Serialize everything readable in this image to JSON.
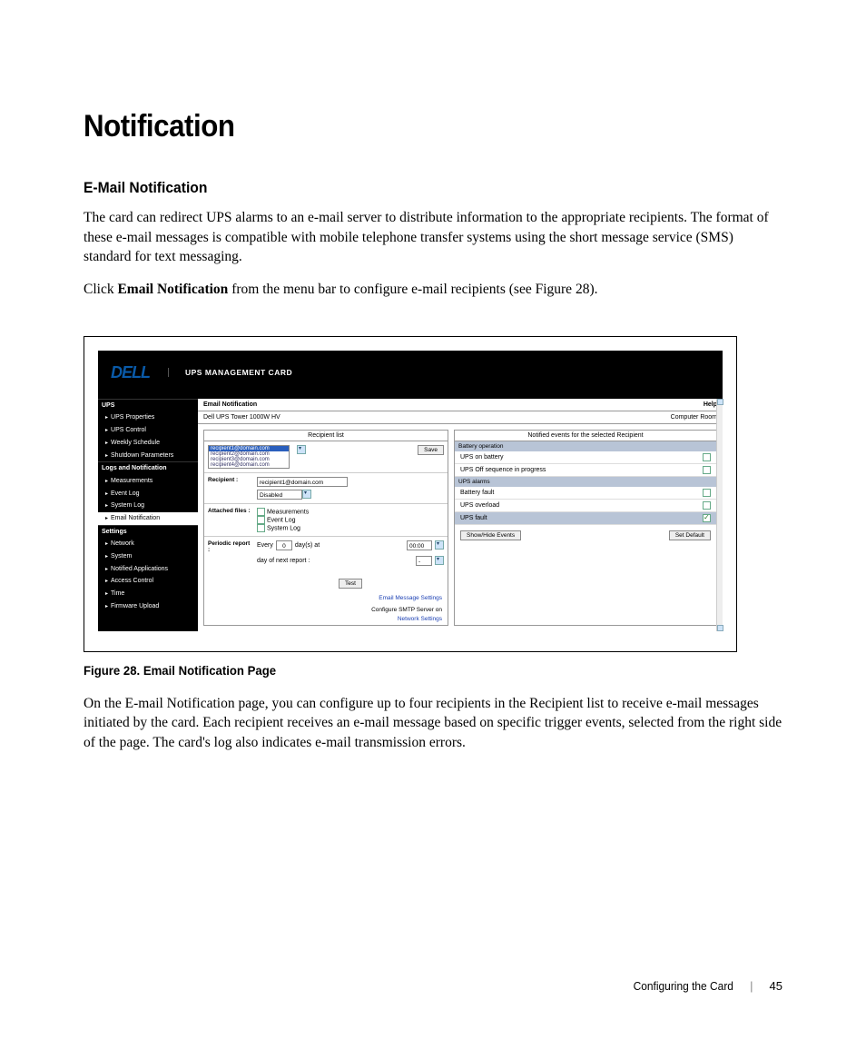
{
  "headings": {
    "h1": "Notification",
    "h2": "E-Mail Notification"
  },
  "paragraphs": {
    "p1": "The card can redirect UPS alarms to an e-mail server to distribute information to the appropriate recipients. The format of these e-mail messages is compatible with mobile telephone transfer systems using the short message service (SMS) standard for text messaging.",
    "p2a": "Click ",
    "p2b": "Email Notification",
    "p2c": " from the menu bar to configure e-mail recipients (see Figure 28).",
    "p3": "On the E-mail Notification page, you can configure up to four recipients in the Recipient list to receive e-mail messages initiated by the card. Each recipient receives an e-mail message based on specific trigger events, selected from the right side of the page. The card's log also indicates e-mail transmission errors."
  },
  "figure_caption": "Figure 28. Email Notification Page",
  "app": {
    "logo": "DELL",
    "title": "UPS MANAGEMENT CARD",
    "sidebar": {
      "sec1": "UPS",
      "s1_items": [
        "UPS Properties",
        "UPS Control",
        "Weekly Schedule",
        "Shutdown Parameters"
      ],
      "sec2": "Logs and Notification",
      "s2_items": [
        "Measurements",
        "Event Log",
        "System Log",
        "Email Notification"
      ],
      "sec3": "Settings",
      "s3_items": [
        "Network",
        "System",
        "Notified Applications",
        "Access Control",
        "Time",
        "Firmware Upload"
      ]
    },
    "bar1_left": "Email Notification",
    "bar1_right": "Help",
    "bar2_left": "Dell UPS Tower 1000W HV",
    "bar2_right": "Computer Room",
    "left_panel": {
      "head": "Recipient list",
      "recipients": [
        "recipient1@domain.com",
        "recipient2@domain.com",
        "recipient3@domain.com",
        "recipient4@domain.com"
      ],
      "save": "Save",
      "recipient_label": "Recipient :",
      "recipient_value": "recipient1@domain.com",
      "disabled": "Disabled",
      "attached_label": "Attached files :",
      "attach_opts": [
        "Measurements",
        "Event Log",
        "System Log"
      ],
      "periodic_label": "Periodic report :",
      "every": "Every",
      "days_val": "0",
      "days_at": "day(s) at",
      "time_val": "00:00",
      "nextreport": "day of next report :",
      "nextreport_val": " - ",
      "test": "Test",
      "link1": "Email Message Settings",
      "conf": "Configure SMTP Server on",
      "link2": "Network Settings"
    },
    "right_panel": {
      "head": "Notified events for the selected Recipient",
      "sec1": "Battery operation",
      "ev1": "UPS on battery",
      "ev2": "UPS Off sequence in progress",
      "sec2": "UPS alarms",
      "ev3": "Battery fault",
      "ev4": "UPS overload",
      "ev5": "UPS fault",
      "btn1": "Show/Hide Events",
      "btn2": "Set Default"
    }
  },
  "footer": {
    "chapter": "Configuring the Card",
    "sep": "|",
    "page": "45"
  }
}
